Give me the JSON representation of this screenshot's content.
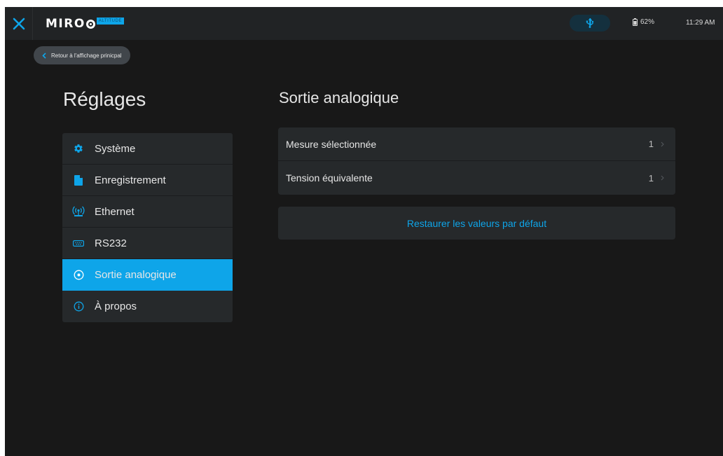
{
  "header": {
    "logo_text": "MIRO",
    "logo_tag": "ALTITUDE",
    "battery": "62%",
    "time": "11:29 AM"
  },
  "nav": {
    "back_label": "Retour à l'affichage prinicpal"
  },
  "page": {
    "title": "Réglages"
  },
  "sidebar": {
    "items": [
      {
        "label": "Système",
        "icon": "gear-icon",
        "active": false
      },
      {
        "label": "Enregistrement",
        "icon": "file-icon",
        "active": false
      },
      {
        "label": "Ethernet",
        "icon": "network-icon",
        "active": false
      },
      {
        "label": "RS232",
        "icon": "serial-port-icon",
        "active": false
      },
      {
        "label": "Sortie analogique",
        "icon": "analog-output-icon",
        "active": true
      },
      {
        "label": "À propos",
        "icon": "info-icon",
        "active": false
      }
    ]
  },
  "content": {
    "title": "Sortie analogique",
    "rows": [
      {
        "label": "Mesure sélectionnée",
        "value": "1"
      },
      {
        "label": "Tension équivalente",
        "value": "1"
      }
    ],
    "restore_label": "Restaurer les valeurs par défaut"
  },
  "colors": {
    "accent": "#0ea5e9",
    "background": "#181818",
    "panel": "#26292b",
    "topbar": "#212325"
  }
}
